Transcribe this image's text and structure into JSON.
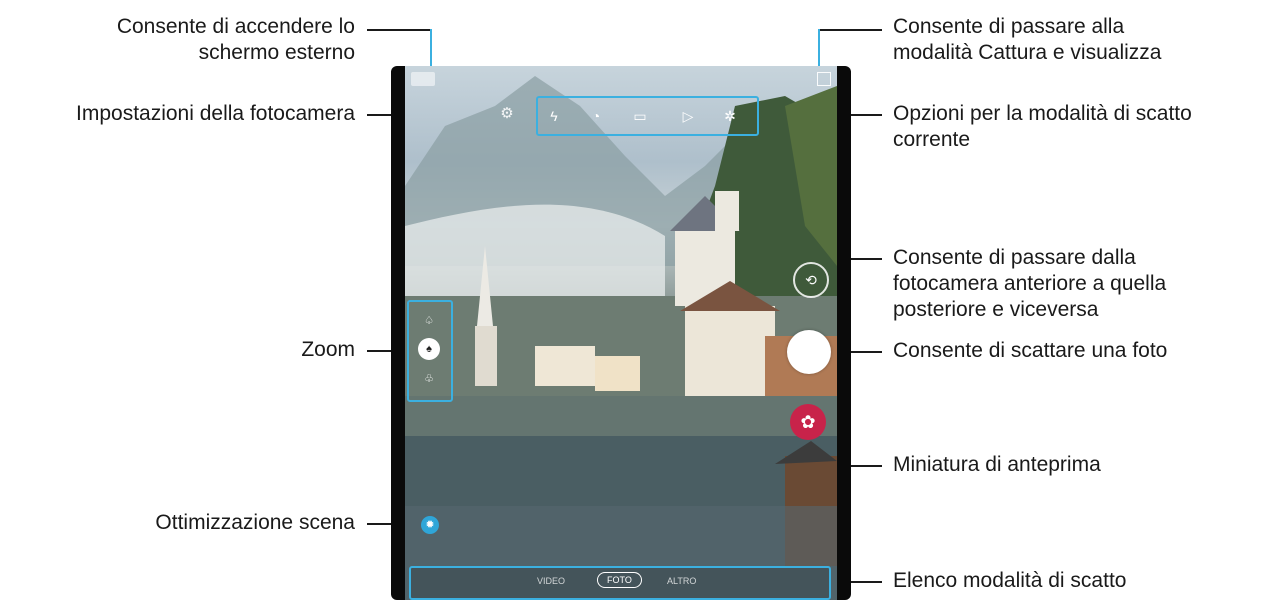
{
  "labels": {
    "screen_on": [
      "Consente di accendere lo",
      "schermo esterno"
    ],
    "capture_mode": [
      "Consente di passare alla",
      "modalità Cattura e visualizza"
    ],
    "camera_settings": "Impostazioni della fotocamera",
    "shooting_options": [
      "Opzioni per la modalità di scatto",
      "corrente"
    ],
    "switch_camera": [
      "Consente di passare dalla",
      "fotocamera anteriore a quella",
      "posteriore e viceversa"
    ],
    "zoom": "Zoom",
    "take_photo": "Consente di scattare una foto",
    "preview_thumbnail": "Miniatura di anteprima",
    "scene_optimizer": "Ottimizzazione scena",
    "shooting_modes": "Elenco modalità di scatto"
  },
  "camera": {
    "modes": [
      "VIDEO",
      "FOTO",
      "ALTRO"
    ],
    "active_mode": "FOTO",
    "icons": [
      "screen-toggle-icon",
      "capture-view-icon",
      "settings-gear-icon",
      "flash-off-icon",
      "timer-icon",
      "aspect-ratio-icon",
      "motion-photo-icon",
      "filter-icon",
      "zoom-ultrawide-icon",
      "zoom-wide-icon",
      "zoom-tele-icon",
      "switch-camera-icon",
      "shutter-icon",
      "thumbnail-icon",
      "scene-optimizer-icon"
    ]
  },
  "colors": {
    "accent": "#3bb0e0",
    "thumbnail": "#c8234a"
  }
}
